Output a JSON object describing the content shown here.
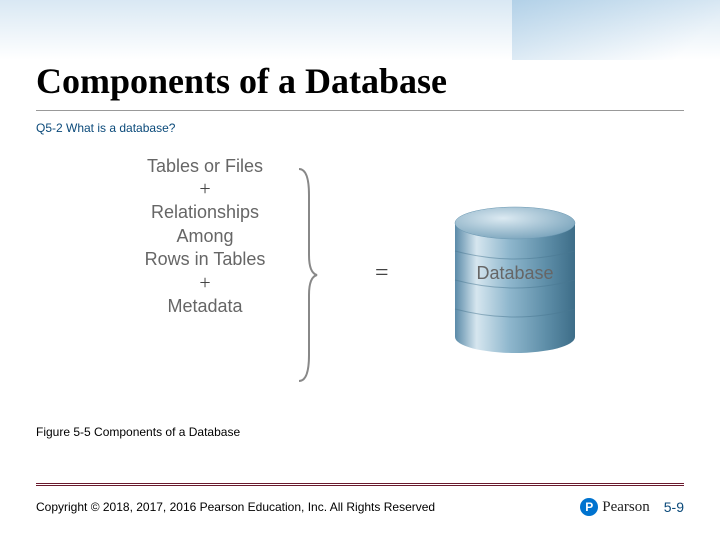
{
  "header": {
    "title": "Components of a Database",
    "subtitle": "Q5-2 What is a database?"
  },
  "diagram": {
    "lines": {
      "tables": "Tables or Files",
      "relationships": "Relationships",
      "among": "Among",
      "rows": "Rows in Tables",
      "metadata": "Metadata",
      "plus": "+"
    },
    "equals": "=",
    "db_label": "Database"
  },
  "figure_caption": "Figure 5-5 Components of a Database",
  "footer": {
    "copyright": "Copyright © 2018, 2017, 2016 Pearson Education, Inc. All Rights Reserved",
    "logo_text": "Pearson",
    "page_num": "5-9"
  }
}
